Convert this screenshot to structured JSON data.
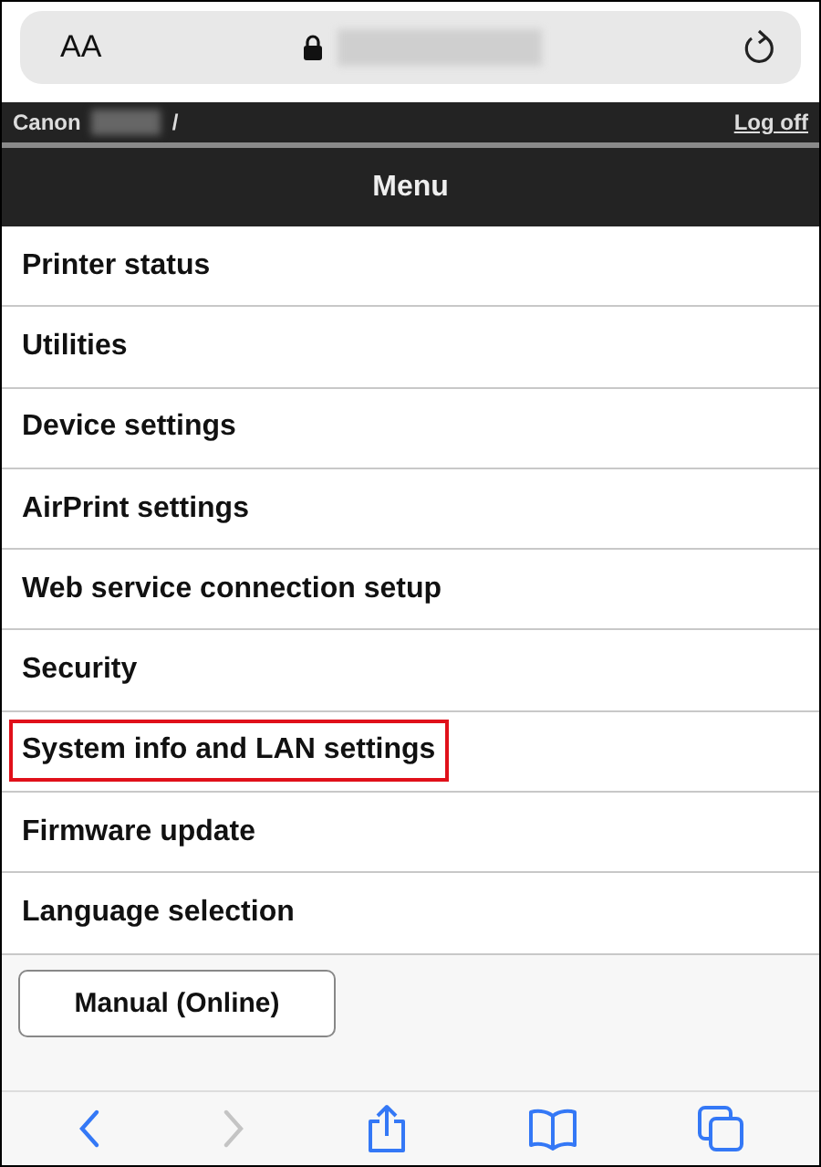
{
  "address_bar": {
    "text_size": "AA"
  },
  "header": {
    "brand": "Canon",
    "separator": "/",
    "logoff": "Log off"
  },
  "menu": {
    "title": "Menu",
    "items": [
      {
        "label": "Printer status",
        "highlighted": false
      },
      {
        "label": "Utilities",
        "highlighted": false
      },
      {
        "label": "Device settings",
        "highlighted": false
      },
      {
        "label": "AirPrint settings",
        "highlighted": false
      },
      {
        "label": "Web service connection setup",
        "highlighted": false
      },
      {
        "label": "Security",
        "highlighted": false
      },
      {
        "label": "System info and LAN settings",
        "highlighted": true
      },
      {
        "label": "Firmware update",
        "highlighted": false
      },
      {
        "label": "Language selection",
        "highlighted": false
      }
    ]
  },
  "manual_button": "Manual (Online)",
  "toolbar": [
    {
      "kind": "back",
      "disabled": false
    },
    {
      "kind": "forward",
      "disabled": true
    },
    {
      "kind": "share",
      "disabled": false
    },
    {
      "kind": "bookmarks",
      "disabled": false
    },
    {
      "kind": "tabs",
      "disabled": false
    }
  ]
}
